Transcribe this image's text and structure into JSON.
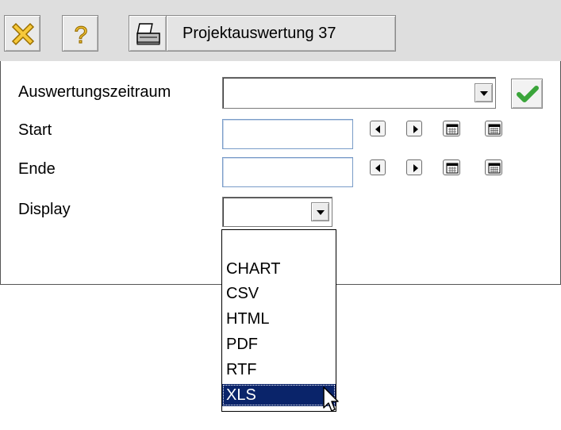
{
  "toolbar": {
    "close_icon": "close-icon",
    "help_icon": "help-icon",
    "print_icon": "printer-icon",
    "title": "Projektauswertung 37"
  },
  "form": {
    "zeitraum_label": "Auswertungszeitraum",
    "zeitraum_value": "",
    "start_label": "Start",
    "start_value": "",
    "ende_label": "Ende",
    "ende_value": "",
    "display_label": "Display",
    "display_value": ""
  },
  "display_options": [
    {
      "label": ""
    },
    {
      "label": "CHART"
    },
    {
      "label": "CSV"
    },
    {
      "label": "HTML"
    },
    {
      "label": "PDF"
    },
    {
      "label": "RTF"
    },
    {
      "label": "XLS"
    }
  ],
  "selected_option": "XLS",
  "colors": {
    "toolbar_bg": "#dedede",
    "selection": "#0a246a",
    "check_green": "#3aa53a"
  }
}
